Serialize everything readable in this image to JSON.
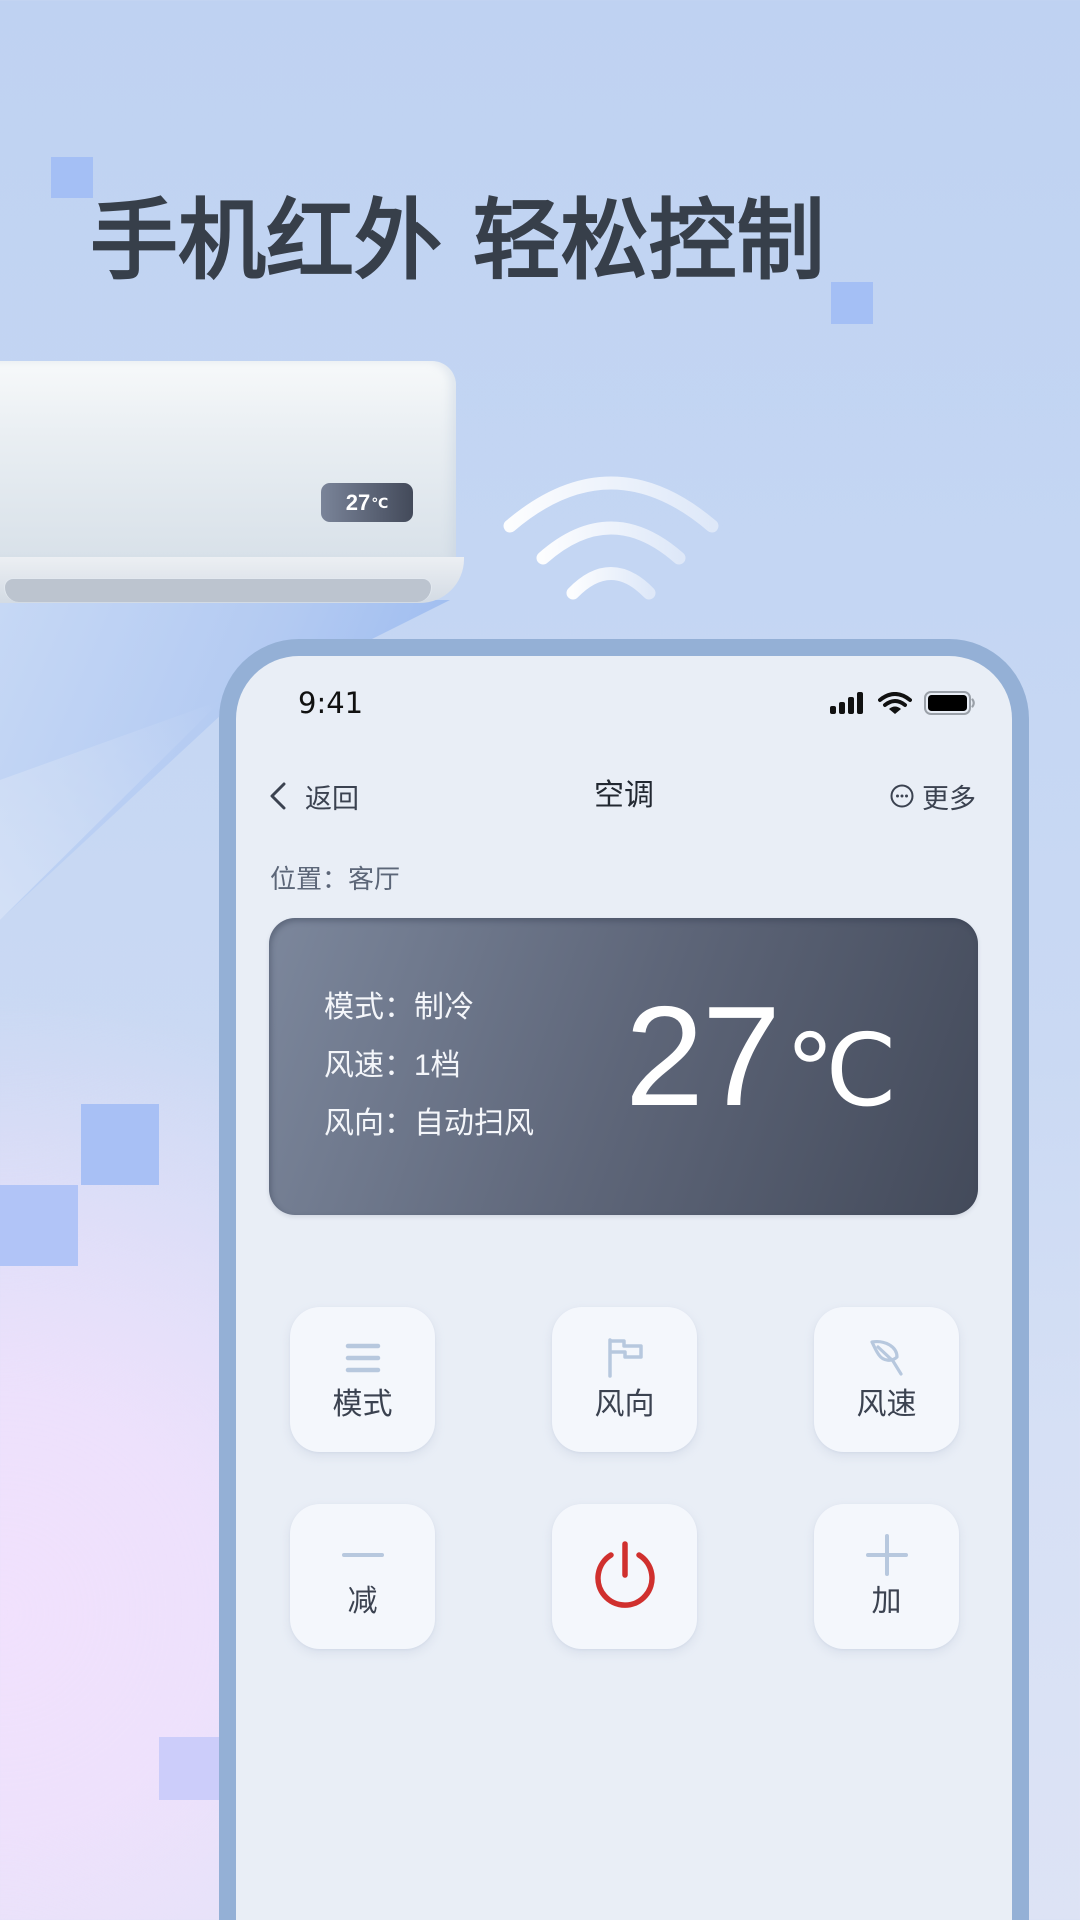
{
  "headline": "手机红外 轻松控制",
  "ac_unit": {
    "display_temp": "27",
    "display_unit": "℃"
  },
  "phone": {
    "status_bar": {
      "time": "9:41",
      "icons": [
        "signal-icon",
        "wifi-icon",
        "battery-icon"
      ]
    },
    "nav": {
      "back_label": "返回",
      "title": "空调",
      "more_label": "更多"
    },
    "location": "位置：客厅",
    "display": {
      "rows": [
        {
          "label": "模式：",
          "value": "制冷"
        },
        {
          "label": "风速：",
          "value": "1档"
        },
        {
          "label": "风向：",
          "value": "自动扫风"
        }
      ],
      "temperature": "27",
      "unit": "℃"
    },
    "controls": [
      {
        "label": "模式",
        "icon": "menu-icon"
      },
      {
        "label": "风向",
        "icon": "flag-icon"
      },
      {
        "label": "风速",
        "icon": "leaf-icon"
      },
      {
        "label": "减",
        "icon": "minus-icon"
      },
      {
        "label": "",
        "icon": "power-icon"
      },
      {
        "label": "加",
        "icon": "plus-icon"
      }
    ]
  },
  "colors": {
    "headline": "#373f4a",
    "phone_frame": "#94b0d6",
    "phone_screen": "#e9eef6",
    "card_gradient_start": "#7c879c",
    "card_gradient_end": "#434a5a",
    "control_icon": "#b7c8de",
    "power_icon": "#d0302e",
    "label_text": "#3b4250",
    "accent_square": "#a4bff5"
  }
}
